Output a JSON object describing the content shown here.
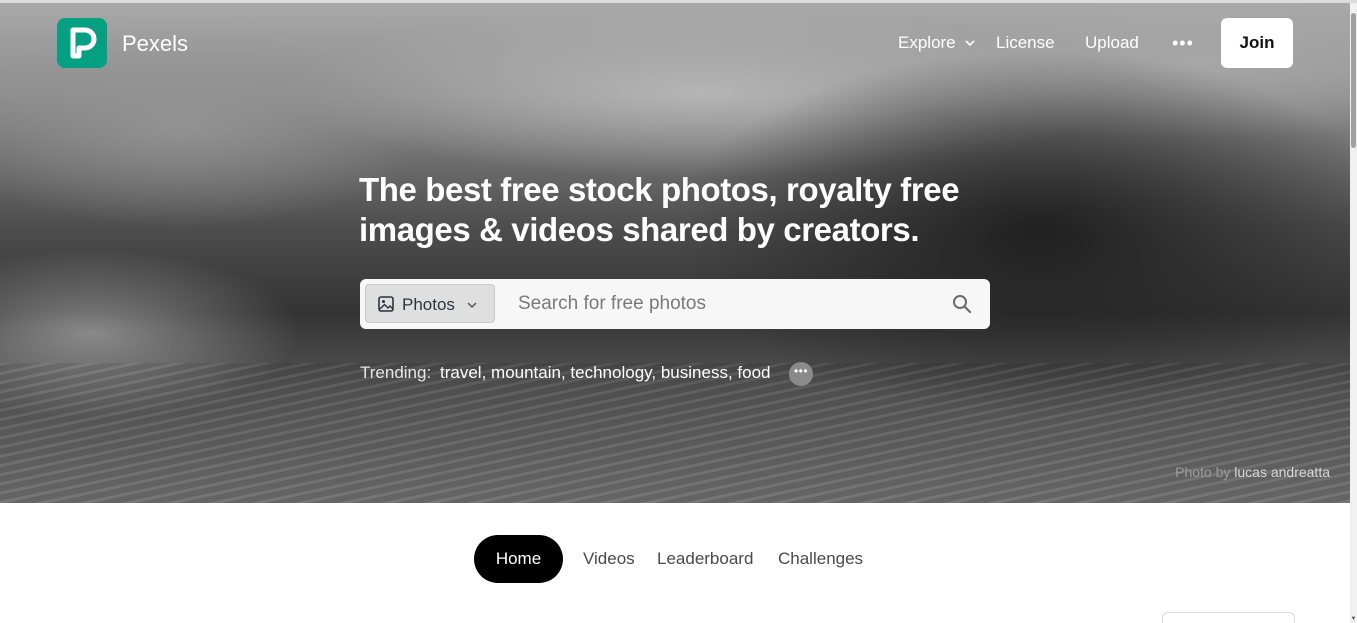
{
  "header": {
    "brand": "Pexels",
    "logo_color": "#05A081",
    "nav": {
      "explore": "Explore",
      "license": "License",
      "upload": "Upload",
      "more_icon": "ellipsis-icon",
      "join": "Join"
    }
  },
  "hero": {
    "headline": "The best free stock photos, royalty free images & videos shared by creators.",
    "search": {
      "type_label": "Photos",
      "placeholder": "Search for free photos"
    },
    "trending": {
      "label": "Trending:",
      "tags": [
        "travel",
        "mountain",
        "technology",
        "business",
        "food"
      ]
    },
    "credit": {
      "prefix": "Photo by",
      "name": "lucas andreatta"
    }
  },
  "tabs": [
    {
      "label": "Home",
      "active": true
    },
    {
      "label": "Videos",
      "active": false
    },
    {
      "label": "Leaderboard",
      "active": false
    },
    {
      "label": "Challenges",
      "active": false
    }
  ],
  "icons": {
    "type": "image-icon",
    "type_dropdown": "chevron-down-icon",
    "search": "search-icon",
    "trend_more": "more-icon",
    "explore_dropdown": "chevron-down-icon"
  }
}
